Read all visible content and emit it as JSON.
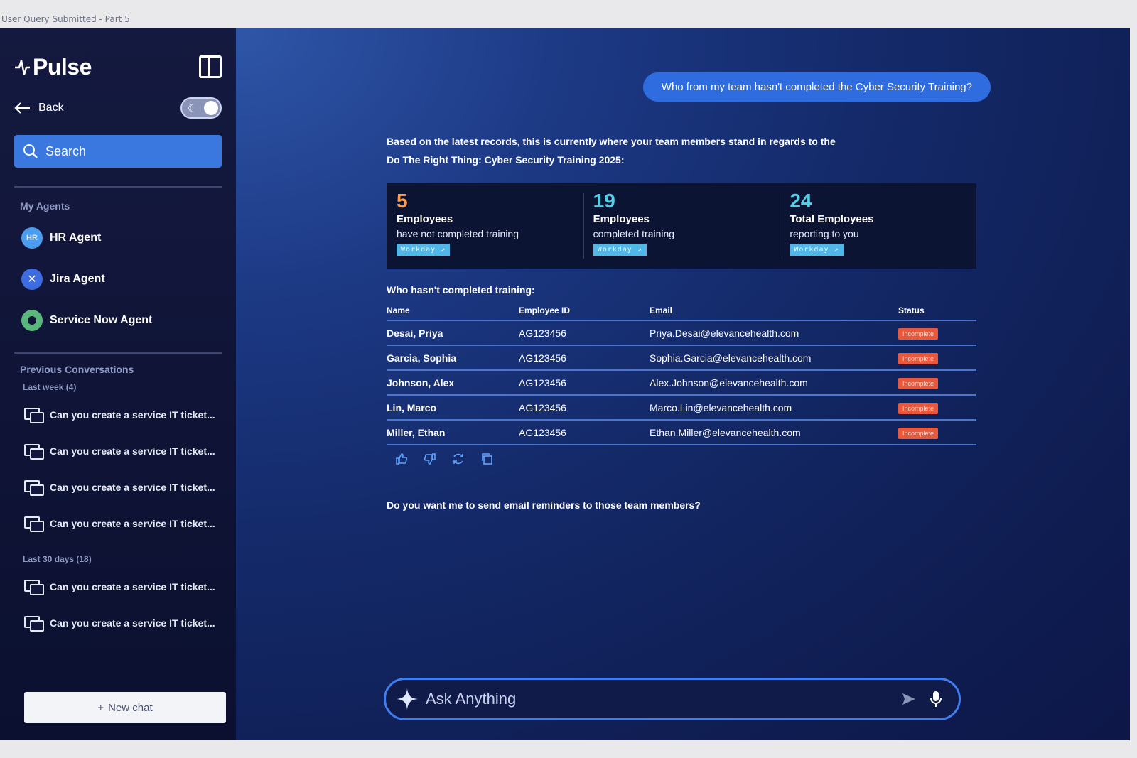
{
  "window": {
    "title": "User Query Submitted - Part 5"
  },
  "sidebar": {
    "brand": "Pulse",
    "back_label": "Back",
    "search": {
      "placeholder": "Search"
    },
    "agents_title": "My Agents",
    "agents": [
      {
        "label": "HR Agent",
        "initials": "HR"
      },
      {
        "label": "Jira Agent",
        "initials": ""
      },
      {
        "label": "Service Now Agent",
        "initials": ""
      }
    ],
    "previous_title": "Previous Conversations",
    "last_week_label": "Last week (4)",
    "last_week": [
      "Can you create a service IT ticket...",
      "Can you create a service IT ticket...",
      "Can you create a service IT ticket...",
      "Can you create a service IT ticket..."
    ],
    "last_30_label": "Last 30 days (18)",
    "last_30": [
      "Can you create a service IT ticket...",
      "Can you create a service IT ticket..."
    ],
    "new_chat": "New chat"
  },
  "chat": {
    "user_message": "Who from my team  hasn't completed the Cyber Security Training?",
    "intro_line1": "Based on the latest records, this is currently where your team members stand in regards to the",
    "intro_line2": "Do The Right Thing: Cyber Security Training 2025:",
    "stats": [
      {
        "value": "5",
        "label": "Employees",
        "desc": "have not completed training",
        "source": "Workday ↗"
      },
      {
        "value": "19",
        "label": "Employees",
        "desc": "completed training",
        "source": "Workday ↗"
      },
      {
        "value": "24",
        "label": "Total Employees",
        "desc": "reporting to you",
        "source": "Workday ↗"
      }
    ],
    "table_title": "Who hasn't completed training:",
    "columns": {
      "name": "Name",
      "id": "Employee ID",
      "email": "Email",
      "status": "Status"
    },
    "rows": [
      {
        "name": "Desai, Priya",
        "id": "AG123456",
        "email": "Priya.Desai@elevancehealth.com",
        "status": "Incomplete"
      },
      {
        "name": "Garcia, Sophia",
        "id": "AG123456",
        "email": "Sophia.Garcia@elevancehealth.com",
        "status": "Incomplete"
      },
      {
        "name": "Johnson, Alex",
        "id": "AG123456",
        "email": "Alex.Johnson@elevancehealth.com",
        "status": "Incomplete"
      },
      {
        "name": "Lin, Marco",
        "id": "AG123456",
        "email": "Marco.Lin@elevancehealth.com",
        "status": "Incomplete"
      },
      {
        "name": "Miller, Ethan",
        "id": "AG123456",
        "email": "Ethan.Miller@elevancehealth.com",
        "status": "Incomplete"
      }
    ],
    "followup": "Do you want me to send email reminders to those team members?",
    "composer": {
      "placeholder": "Ask Anything"
    }
  },
  "colors": {
    "accent": "#3a78e0",
    "incomplete": "#e8583c",
    "stat_orange": "#ff9c4a",
    "stat_teal": "#4fd0e6"
  },
  "icons": [
    "panel-toggle-icon",
    "back-arrow-icon",
    "moon-icon",
    "search-icon",
    "chat-bubbles-icon",
    "thumbs-up-icon",
    "thumbs-down-icon",
    "refresh-icon",
    "copy-icon",
    "sparkle-icon",
    "send-icon",
    "microphone-icon",
    "plus-icon"
  ]
}
